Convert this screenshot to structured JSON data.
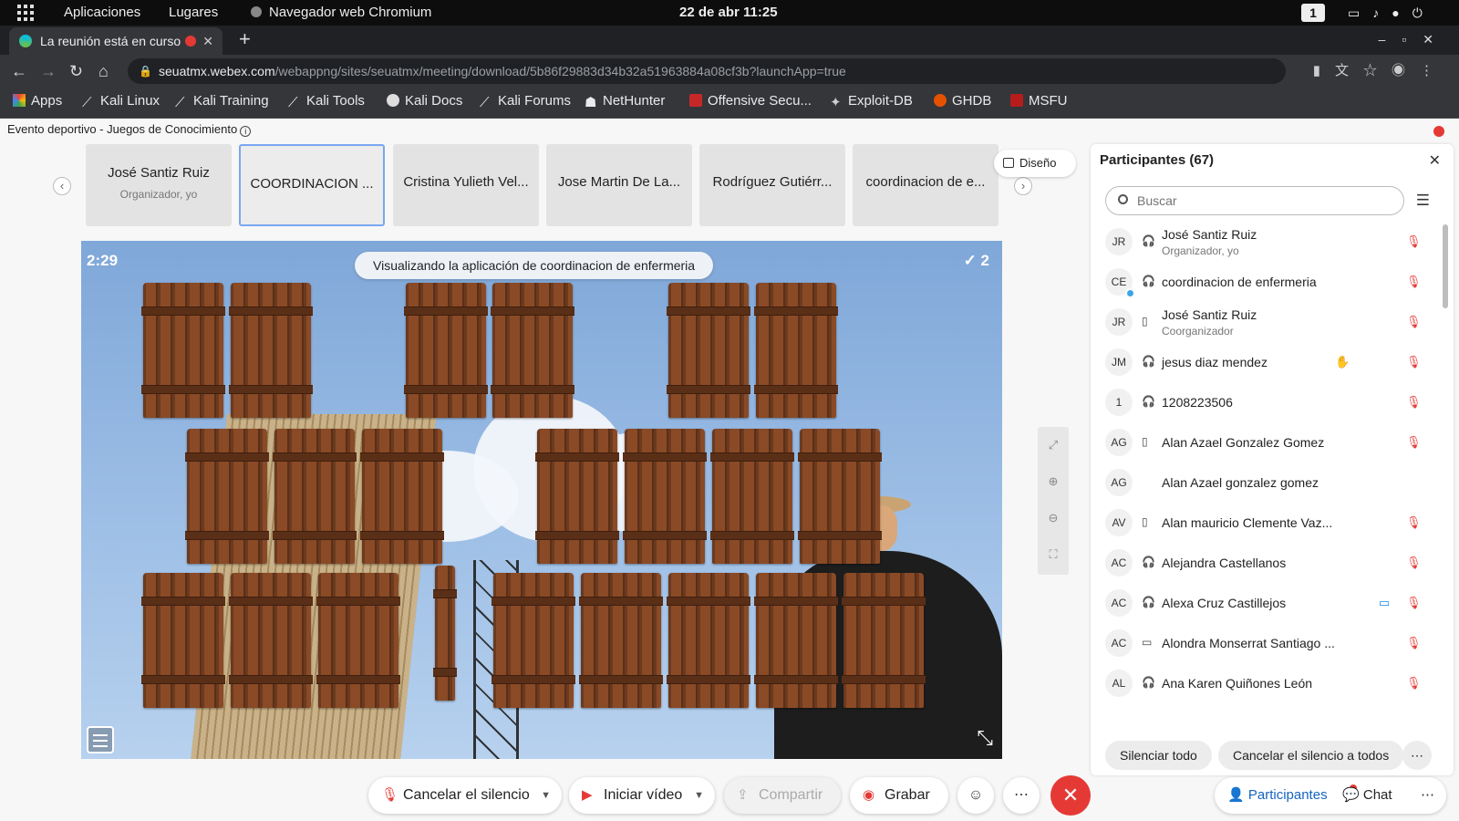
{
  "topbar": {
    "apps_label": "Aplicaciones",
    "places_label": "Lugares",
    "app_name": "Navegador web Chromium",
    "clock": "22 de abr  11:25",
    "workspace": "1",
    "icons": [
      "screen-icon",
      "volume-icon",
      "mic-icon",
      "power-icon"
    ]
  },
  "browser": {
    "tab_title": "La reunión está en curso",
    "url_host": "seuatmx.webex.com",
    "url_path": "/webappng/sites/seuatmx/meeting/download/5b86f29883d34b32a51963884a08cf3b?launchApp=true",
    "bookmarks": [
      {
        "label": "Apps",
        "icon": "apps-grid-icon"
      },
      {
        "label": "Kali Linux",
        "icon": "kali-icon"
      },
      {
        "label": "Kali Training",
        "icon": "kali-icon"
      },
      {
        "label": "Kali Tools",
        "icon": "kali-icon"
      },
      {
        "label": "Kali Docs",
        "icon": "globe-icon"
      },
      {
        "label": "Kali Forums",
        "icon": "kali-icon"
      },
      {
        "label": "NetHunter",
        "icon": "nethunter-icon"
      },
      {
        "label": "Offensive Secu...",
        "icon": "offsec-icon"
      },
      {
        "label": "Exploit-DB",
        "icon": "exploitdb-icon"
      },
      {
        "label": "GHDB",
        "icon": "ghdb-icon"
      },
      {
        "label": "MSFU",
        "icon": "msfu-icon"
      }
    ]
  },
  "meeting": {
    "title": "Evento deportivo - Juegos de Conocimiento",
    "layout_label": "Diseño",
    "tiles": [
      {
        "name": "José Santiz Ruiz",
        "sub": "Organizador, yo"
      },
      {
        "name": "COORDINACION ...",
        "sub": ""
      },
      {
        "name": "Cristina Yulieth Vel...",
        "sub": ""
      },
      {
        "name": "Jose Martin De La...",
        "sub": ""
      },
      {
        "name": "Rodríguez Gutiérr...",
        "sub": ""
      },
      {
        "name": "coordinacion de e...",
        "sub": ""
      }
    ],
    "share_banner": "Visualizando la aplicación de coordinacion de enfermeria",
    "game": {
      "timer": "2:29",
      "score": "✓ 2"
    }
  },
  "controls": {
    "unmute": "Cancelar el silencio",
    "start_video": "Iniciar vídeo",
    "share": "Compartir",
    "record": "Grabar",
    "participants": "Participantes",
    "chat": "Chat"
  },
  "panel": {
    "title": "Participantes (67)",
    "search_placeholder": "Buscar",
    "mute_all": "Silenciar todo",
    "unmute_all": "Cancelar el silencio a todos",
    "participants": [
      {
        "initials": "JR",
        "name": "José Santiz Ruiz",
        "sub": "Organizador, yo",
        "device": "headset",
        "muted": true
      },
      {
        "initials": "CE",
        "name": "coordinacion de enfermeria",
        "sub": "",
        "device": "headset",
        "muted": true,
        "presenting": true
      },
      {
        "initials": "JR",
        "name": "José Santiz Ruiz",
        "sub": "Coorganizador",
        "device": "mobile",
        "muted": true
      },
      {
        "initials": "JM",
        "name": "jesus diaz mendez",
        "sub": "",
        "device": "headset",
        "muted": true,
        "hand_raised": true
      },
      {
        "initials": "1",
        "name": "1208223506",
        "sub": "",
        "device": "headset",
        "muted": true
      },
      {
        "initials": "AG",
        "name": "Alan Azael Gonzalez Gomez",
        "sub": "",
        "device": "mobile",
        "muted": true
      },
      {
        "initials": "AG",
        "name": "Alan Azael gonzalez gomez",
        "sub": "",
        "device": "",
        "muted": false
      },
      {
        "initials": "AV",
        "name": "Alan mauricio Clemente Vaz...",
        "sub": "",
        "device": "mobile",
        "muted": true
      },
      {
        "initials": "AC",
        "name": "Alejandra Castellanos",
        "sub": "",
        "device": "headset",
        "muted": true
      },
      {
        "initials": "AC",
        "name": "Alexa Cruz Castillejos",
        "sub": "",
        "device": "headset",
        "muted": true,
        "video": true
      },
      {
        "initials": "AC",
        "name": "Alondra Monserrat Santiago ...",
        "sub": "",
        "device": "desktop",
        "muted": true
      },
      {
        "initials": "AL",
        "name": "Ana Karen Quiñones León",
        "sub": "",
        "device": "headset",
        "muted": true
      }
    ]
  },
  "colors": {
    "accent": "#1565c0",
    "danger": "#e53935",
    "sky": "#9bbde5",
    "wood": "#7a4222"
  }
}
